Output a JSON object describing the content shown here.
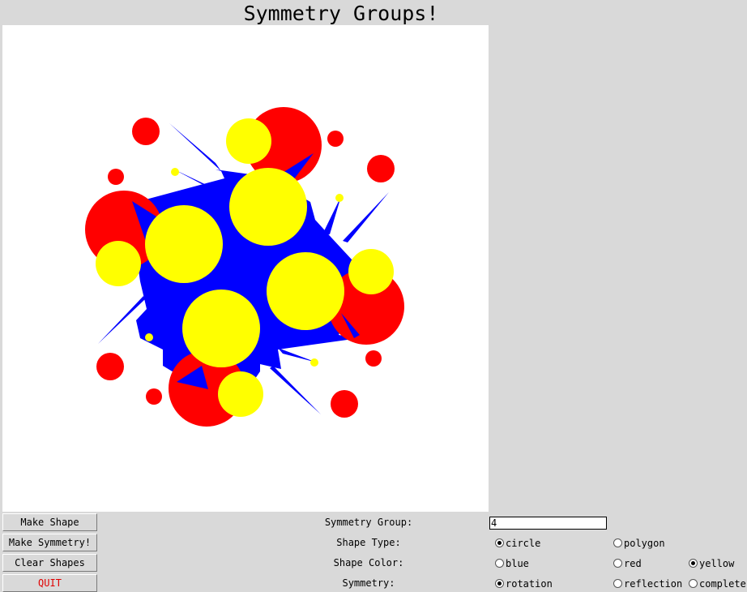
{
  "window": {
    "title": "Symmetry Groups!"
  },
  "colors": {
    "red": "#ff0000",
    "yellow": "#ffff00",
    "blue": "#0000ff",
    "quit": "#e00000"
  },
  "buttons": {
    "make_shape": "Make Shape",
    "make_symmetry": "Make Symmetry!",
    "clear_shapes": "Clear Shapes",
    "quit": "QUIT"
  },
  "controls": {
    "symmetry_group_label": "Symmetry Group:",
    "symmetry_group_value": "4",
    "shape_type_label": "Shape Type:",
    "shape_color_label": "Shape Color:",
    "symmetry_label": "Symmetry:"
  },
  "options": {
    "shape_type": [
      {
        "label": "circle",
        "selected": true
      },
      {
        "label": "polygon",
        "selected": false
      }
    ],
    "shape_color": [
      {
        "label": "blue",
        "selected": false
      },
      {
        "label": "red",
        "selected": false
      },
      {
        "label": "yellow",
        "selected": true
      }
    ],
    "symmetry": [
      {
        "label": "rotation",
        "selected": true
      },
      {
        "label": "reflection",
        "selected": false
      },
      {
        "label": "complete",
        "selected": false
      }
    ]
  }
}
